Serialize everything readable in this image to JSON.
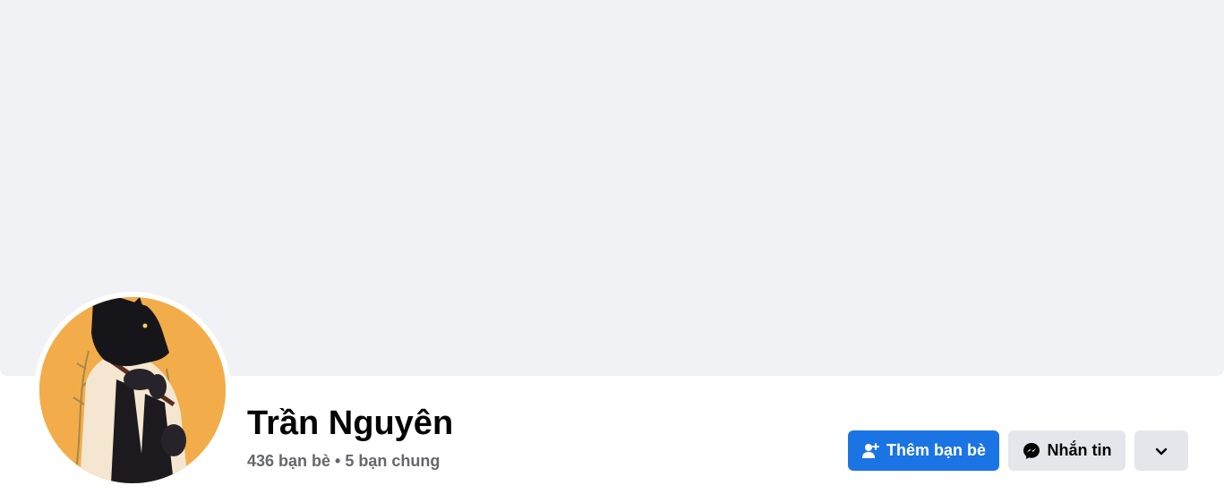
{
  "profile": {
    "name": "Trần Nguyên",
    "friends_count": "436 bạn bè",
    "separator": " • ",
    "mutual_friends": "5 bạn chung"
  },
  "actions": {
    "add_friend_label": "Thêm bạn bè",
    "message_label": "Nhắn tin",
    "more_icon": "chevron-down-icon"
  },
  "colors": {
    "cover_background": "#f0f2f5",
    "primary_button": "#1b74e4",
    "secondary_button": "#e4e6eb",
    "avatar_background": "#f2ad4a"
  }
}
